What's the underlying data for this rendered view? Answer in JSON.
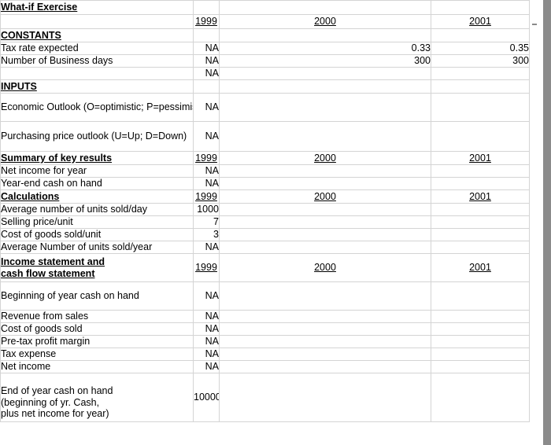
{
  "sheet": {
    "title": "What-if Exercise",
    "years": {
      "y1": "1999",
      "y2": "2000",
      "y3": "2001"
    },
    "sections": {
      "constants": "CONSTANTS",
      "inputs": "INPUTS",
      "summary": "Summary of key results",
      "calculations": "Calculations",
      "income_line1": "Income statement and ",
      "income_line2": "cash flow statement"
    },
    "rows": {
      "tax_rate": {
        "label": "Tax rate expected",
        "y1999": "NA",
        "y2000": "0.33",
        "y2001": "0.35"
      },
      "business_days": {
        "label": "Number of Business days",
        "y1999": "NA",
        "y2000": "300",
        "y2001": "300"
      },
      "blank_constant": {
        "label": "",
        "y1999": "NA",
        "y2000": "",
        "y2001": ""
      },
      "economic_outlook": {
        "label": "Economic Outlook (O=optimistic; P=pessimistic)",
        "y1999": "NA",
        "y2000": "",
        "y2001": ""
      },
      "purchasing_outlook": {
        "label": "Purchasing price outlook (U=Up; D=Down)",
        "y1999": "NA",
        "y2000": "",
        "y2001": ""
      },
      "net_income_for_year": {
        "label": "Net income for year",
        "y1999": "NA",
        "y2000": "",
        "y2001": ""
      },
      "year_end_cash": {
        "label": "Year-end cash on hand",
        "y1999": "NA",
        "y2000": "",
        "y2001": ""
      },
      "units_per_day": {
        "label": "Average number of units sold/day",
        "y1999": "1000",
        "y2000": "",
        "y2001": ""
      },
      "selling_price": {
        "label": "Selling price/unit",
        "y1999": "7",
        "y2000": "",
        "y2001": ""
      },
      "cogs_unit": {
        "label": "Cost of goods sold/unit",
        "y1999": "3",
        "y2000": "",
        "y2001": ""
      },
      "units_per_year": {
        "label": "Average Number of units sold/year",
        "y1999": "NA",
        "y2000": "",
        "y2001": ""
      },
      "beginning_cash": {
        "label": "Beginning of year cash on hand",
        "y1999": "NA",
        "y2000": "",
        "y2001": ""
      },
      "revenue": {
        "label": "Revenue from sales",
        "y1999": "NA",
        "y2000": "",
        "y2001": ""
      },
      "cogs": {
        "label": "Cost of goods sold",
        "y1999": "NA",
        "y2000": "",
        "y2001": ""
      },
      "pretax_margin": {
        "label": "Pre-tax profit margin",
        "y1999": "NA",
        "y2000": "",
        "y2001": ""
      },
      "tax_expense": {
        "label": "Tax expense",
        "y1999": "NA",
        "y2000": "",
        "y2001": ""
      },
      "net_income": {
        "label": "Net income",
        "y1999": "NA",
        "y2000": "",
        "y2001": ""
      },
      "end_cash": {
        "label_line1": "End of year cash on hand",
        "label_line2": "(beginning of yr. Cash,",
        "label_line3": "plus net income for year)",
        "y1999": "10000",
        "y2000": "",
        "y2001": ""
      }
    }
  }
}
